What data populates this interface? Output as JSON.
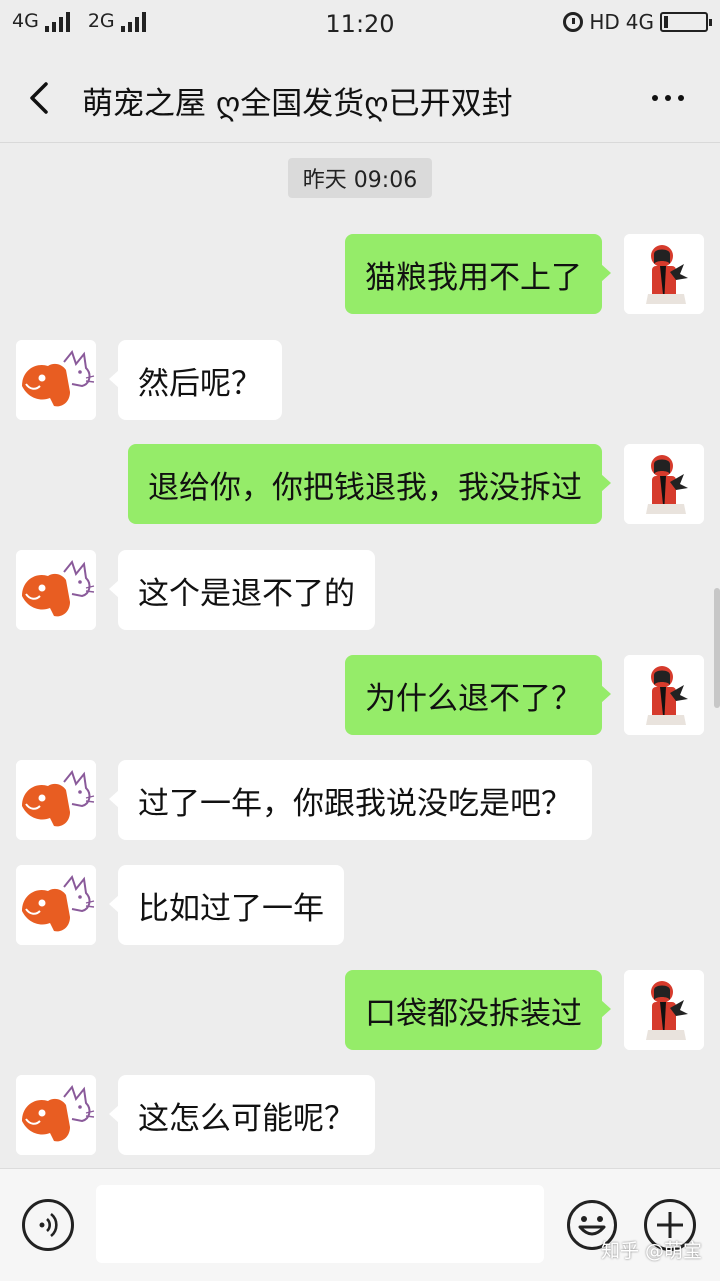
{
  "status_bar": {
    "net1": "4G",
    "net2": "2G",
    "time": "11:20",
    "hd": "HD",
    "net3": "4G",
    "icons": [
      "signal-icon",
      "alarm-icon",
      "battery-icon"
    ]
  },
  "nav": {
    "title": "萌宠之屋 ღ全国发货ღ已开双封",
    "icons": [
      "back-arrow-icon",
      "more-dots-icon"
    ]
  },
  "chat": {
    "timestamp": "昨天 09:06",
    "messages": [
      {
        "from": "me",
        "text": "猫粮我用不上了"
      },
      {
        "from": "shop",
        "text": "然后呢？"
      },
      {
        "from": "me",
        "text": "退给你，你把钱退我，我没拆过"
      },
      {
        "from": "shop",
        "text": "这个是退不了的"
      },
      {
        "from": "me",
        "text": "为什么退不了？"
      },
      {
        "from": "shop",
        "text": "过了一年，你跟我说没吃是吧？"
      },
      {
        "from": "shop",
        "text": "比如过了一年"
      },
      {
        "from": "me",
        "text": "口袋都没拆装过"
      },
      {
        "from": "shop",
        "text": "这怎么可能呢？"
      }
    ],
    "colors": {
      "outgoing_bubble": "#95ec69",
      "incoming_bubble": "#ffffff",
      "background": "#ededed"
    }
  },
  "input_bar": {
    "text_value": "",
    "icons": [
      "voice-icon",
      "emoji-icon",
      "plus-icon"
    ]
  },
  "watermark": "知乎 @萌宝"
}
